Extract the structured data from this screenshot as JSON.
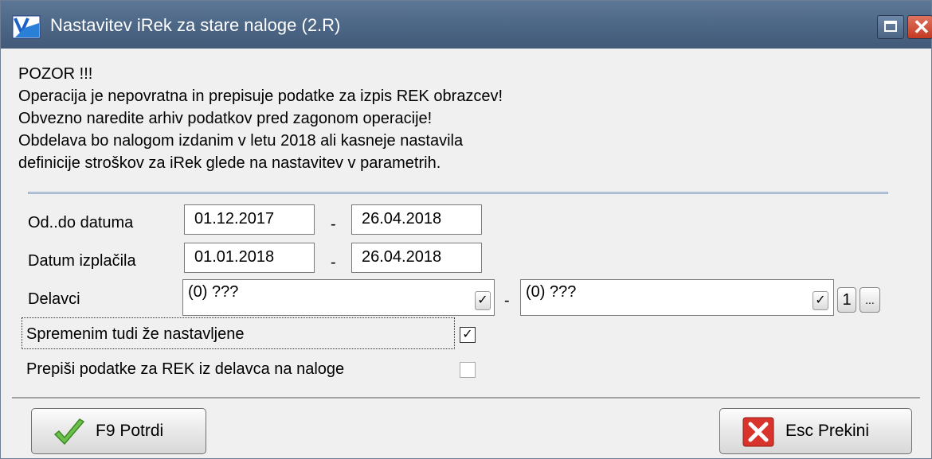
{
  "window": {
    "title": "Nastavitev iRek za stare naloge  (2.R)"
  },
  "warning": {
    "lines": [
      "POZOR !!!",
      "Operacija je nepovratna in prepisuje podatke za izpis REK obrazcev!",
      "Obvezno naredite arhiv podatkov pred zagonom operacije!",
      "Obdelava bo nalogom izdanim v letu 2018 ali kasneje nastavila",
      "definicije stroškov za iRek glede na nastavitev v parametrih."
    ]
  },
  "form": {
    "date_range": {
      "label": "Od..do datuma",
      "from": "01.12.2017",
      "to": "26.04.2018",
      "sep": "-"
    },
    "payout_range": {
      "label": "Datum izplačila",
      "from": "01.01.2018",
      "to": "26.04.2018",
      "sep": "-"
    },
    "workers": {
      "label": "Delavci",
      "from": "(0) ???",
      "to": "(0) ???",
      "sep": "-",
      "btn_1": "1",
      "btn_more": "..."
    },
    "change_existing": {
      "label": "Spremenim tudi že nastavljene",
      "checked": true
    },
    "copy_rek": {
      "label": "Prepiši podatke za REK iz delavca na naloge",
      "checked": false
    }
  },
  "buttons": {
    "confirm": "F9 Potrdi",
    "cancel": "Esc Prekini"
  },
  "colors": {
    "titlebar": "#4d6786",
    "confirm_icon": "#6cc04a",
    "cancel_icon": "#d9342b"
  }
}
